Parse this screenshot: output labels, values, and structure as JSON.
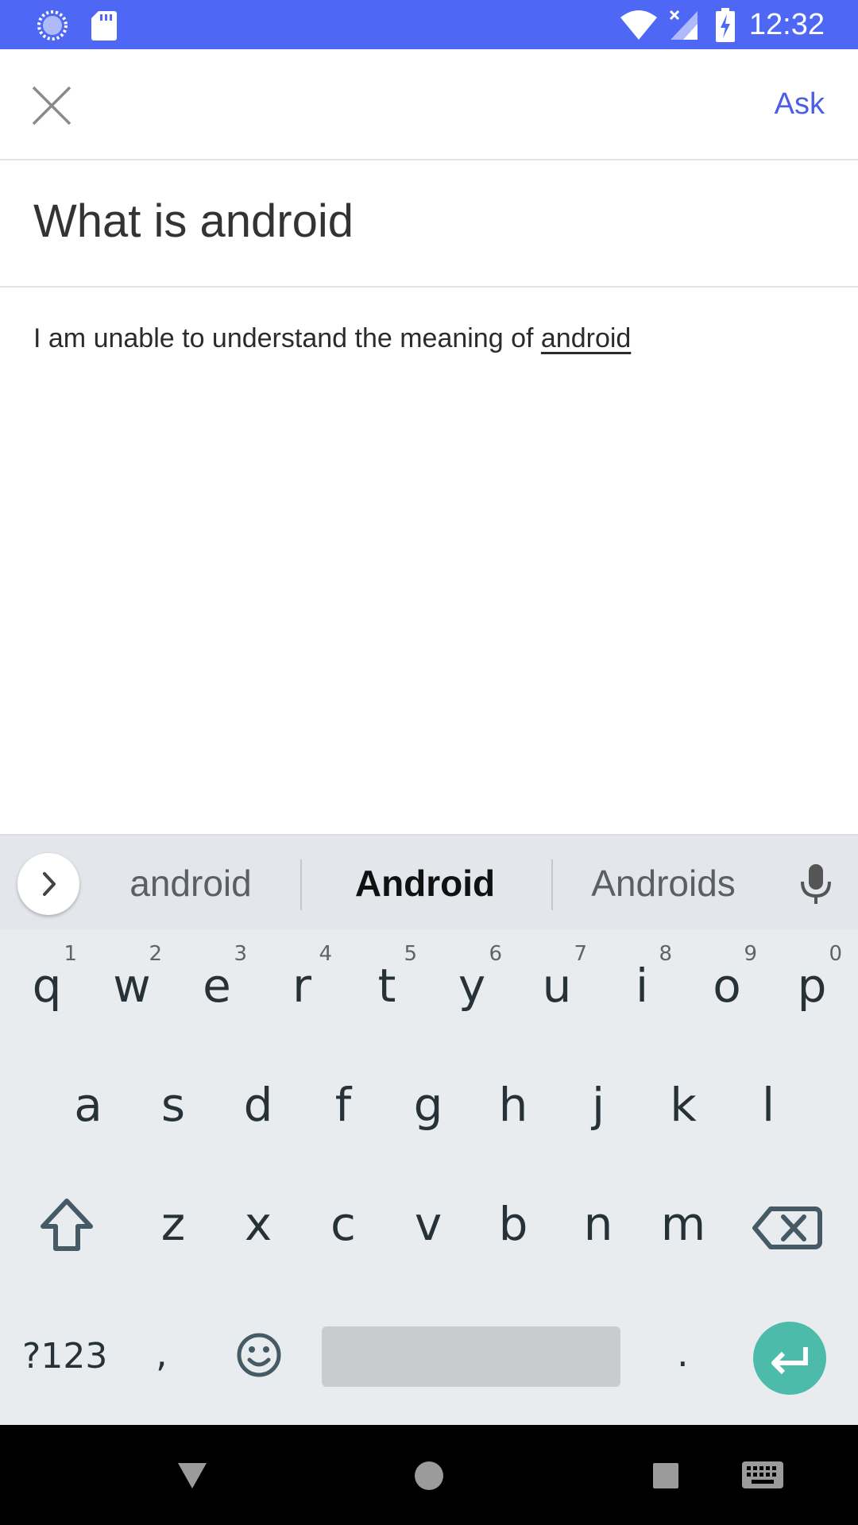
{
  "status_bar": {
    "time": "12:32",
    "icons": [
      "loading-circle-icon",
      "sd-card-icon",
      "wifi-icon",
      "signal-no-data-icon",
      "battery-charging-icon"
    ],
    "background": "#4f67f5"
  },
  "app_bar": {
    "close_icon": "close-icon",
    "ask_label": "Ask",
    "accent": "#4a5ee8"
  },
  "question": "What is android",
  "answer": {
    "text": "I am unable to understand the meaning of ",
    "link": "android"
  },
  "keyboard": {
    "suggestions": [
      "android",
      "Android",
      "Androids"
    ],
    "row1": [
      {
        "key": "q",
        "hint": "1"
      },
      {
        "key": "w",
        "hint": "2"
      },
      {
        "key": "e",
        "hint": "3"
      },
      {
        "key": "r",
        "hint": "4"
      },
      {
        "key": "t",
        "hint": "5"
      },
      {
        "key": "y",
        "hint": "6"
      },
      {
        "key": "u",
        "hint": "7"
      },
      {
        "key": "i",
        "hint": "8"
      },
      {
        "key": "o",
        "hint": "9"
      },
      {
        "key": "p",
        "hint": "0"
      }
    ],
    "row2": [
      "a",
      "s",
      "d",
      "f",
      "g",
      "h",
      "j",
      "k",
      "l"
    ],
    "row3": [
      "z",
      "x",
      "c",
      "v",
      "b",
      "n",
      "m"
    ],
    "symbols_label": "?123",
    "comma": ",",
    "period": ".",
    "enter_color": "#4cbba9"
  },
  "nav_bar": {
    "icons": [
      "back-triangle-icon",
      "home-circle-icon",
      "recents-square-icon",
      "keyboard-switch-icon"
    ]
  }
}
